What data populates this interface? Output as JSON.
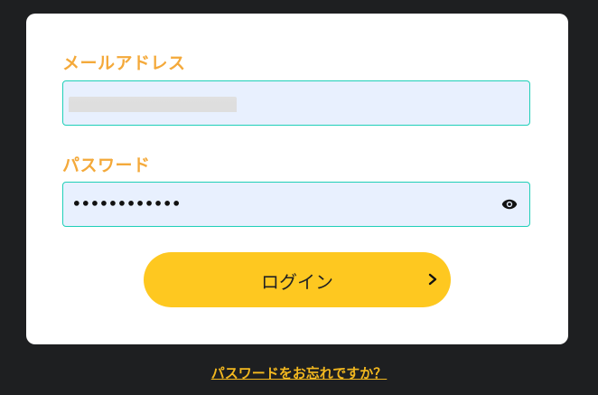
{
  "form": {
    "email_label": "メールアドレス",
    "password_label": "パスワード",
    "password_value": "••••••••••••",
    "login_button_label": "ログイン",
    "forgot_password_link": "パスワードをお忘れですか？"
  },
  "icons": {
    "password_toggle": "eye-icon",
    "login_arrow": "chevron-right-icon"
  },
  "colors": {
    "page_background": "#1e1f21",
    "card_background": "#ffffff",
    "label_color": "#f4a93a",
    "input_background": "#e8f0fe",
    "input_border": "#1fcfb8",
    "button_background": "#fec820",
    "link_color": "#f3b81f"
  }
}
